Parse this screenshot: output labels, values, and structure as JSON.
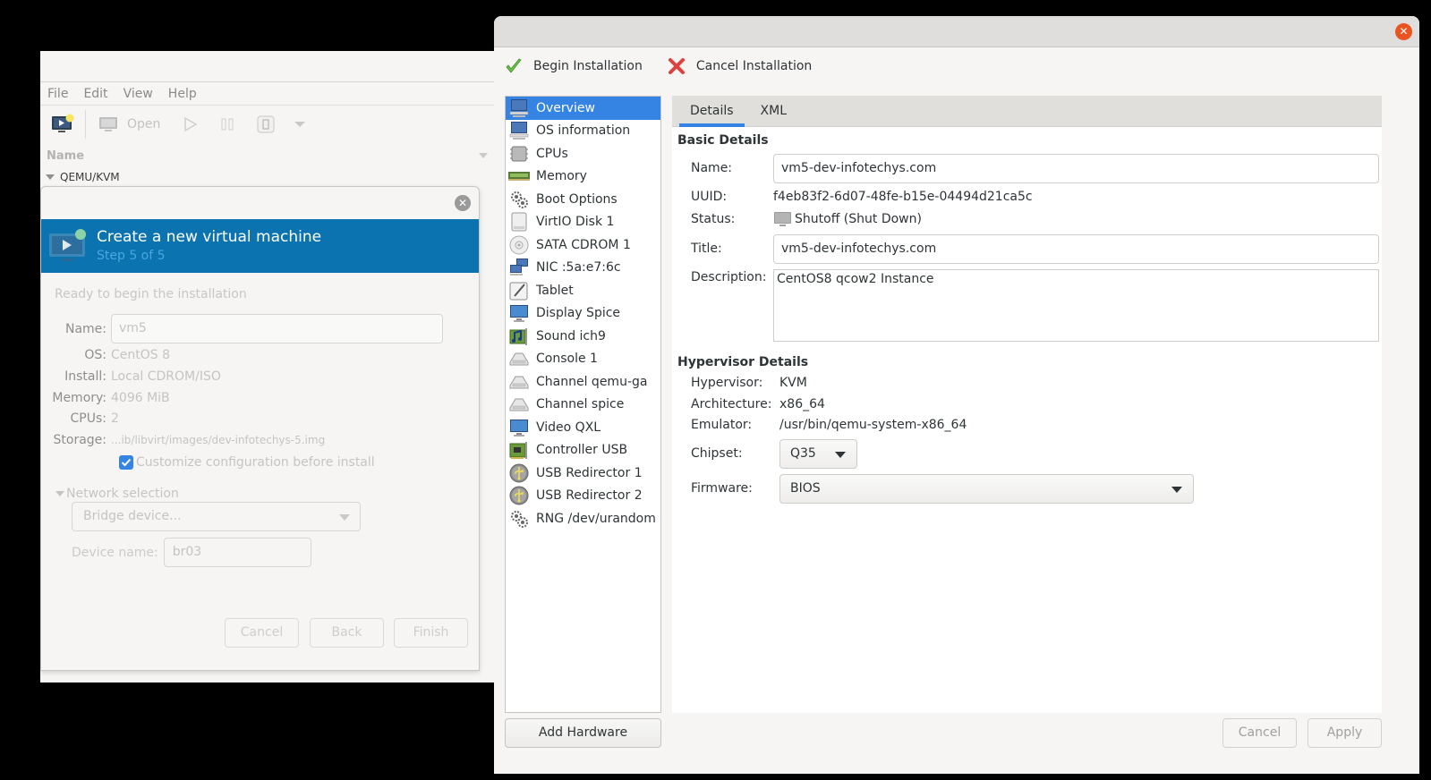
{
  "manager": {
    "menu": [
      "File",
      "Edit",
      "View",
      "Help"
    ],
    "toolbar": {
      "open_label": "Open"
    },
    "column_header": "Name",
    "tree_root": "QEMU/KVM"
  },
  "wizard": {
    "title": "Create a new virtual machine",
    "step": "Step 5 of 5",
    "ready_text": "Ready to begin the installation",
    "fields": {
      "name_label": "Name:",
      "name_value": "vm5",
      "os_label": "OS:",
      "os_value": "CentOS 8",
      "install_label": "Install:",
      "install_value": "Local CDROM/ISO",
      "memory_label": "Memory:",
      "memory_value": "4096 MiB",
      "cpus_label": "CPUs:",
      "cpus_value": "2",
      "storage_label": "Storage:",
      "storage_value": "...ib/libvirt/images/dev-infotechys-5.img"
    },
    "customize_label": "Customize configuration before install",
    "customize_checked": true,
    "network_section": "Network selection",
    "network_source": "Bridge device...",
    "device_name_label": "Device name:",
    "device_name_value": "br03",
    "buttons": {
      "cancel": "Cancel",
      "back": "Back",
      "finish": "Finish"
    }
  },
  "details_window": {
    "actions": {
      "begin": "Begin Installation",
      "cancel": "Cancel Installation"
    },
    "hardware_list": [
      {
        "label": "Overview",
        "icon": "monitor-computer-icon",
        "selected": true
      },
      {
        "label": "OS information",
        "icon": "monitor-computer-icon"
      },
      {
        "label": "CPUs",
        "icon": "cpu-chip-icon"
      },
      {
        "label": "Memory",
        "icon": "memory-module-icon"
      },
      {
        "label": "Boot Options",
        "icon": "gears-icon"
      },
      {
        "label": "VirtIO Disk 1",
        "icon": "hard-disk-icon"
      },
      {
        "label": "SATA CDROM 1",
        "icon": "cdrom-disc-icon"
      },
      {
        "label": "NIC :5a:e7:6c",
        "icon": "network-icon"
      },
      {
        "label": "Tablet",
        "icon": "tablet-pen-icon"
      },
      {
        "label": "Display Spice",
        "icon": "display-icon"
      },
      {
        "label": "Sound ich9",
        "icon": "sound-card-icon"
      },
      {
        "label": "Console 1",
        "icon": "serial-port-icon"
      },
      {
        "label": "Channel qemu-ga",
        "icon": "serial-port-icon"
      },
      {
        "label": "Channel spice",
        "icon": "serial-port-icon"
      },
      {
        "label": "Video QXL",
        "icon": "display-icon"
      },
      {
        "label": "Controller USB",
        "icon": "pci-card-icon"
      },
      {
        "label": "USB Redirector 1",
        "icon": "usb-icon"
      },
      {
        "label": "USB Redirector 2",
        "icon": "usb-icon"
      },
      {
        "label": "RNG /dev/urandom",
        "icon": "gears-icon"
      }
    ],
    "add_hardware": "Add Hardware",
    "tabs": [
      {
        "label": "Details",
        "active": true
      },
      {
        "label": "XML",
        "active": false
      }
    ],
    "basic": {
      "heading": "Basic Details",
      "name_label": "Name:",
      "name_value": "vm5-dev-infotechys.com",
      "uuid_label": "UUID:",
      "uuid_value": "f4eb83f2-6d07-48fe-b15e-04494d21ca5c",
      "status_label": "Status:",
      "status_value": "Shutoff (Shut Down)",
      "title_label": "Title:",
      "title_value": "vm5-dev-infotechys.com",
      "description_label": "Description:",
      "description_value": "CentOS8 qcow2 Instance"
    },
    "hypervisor": {
      "heading": "Hypervisor Details",
      "hypervisor_label": "Hypervisor:",
      "hypervisor_value": "KVM",
      "arch_label": "Architecture:",
      "arch_value": "x86_64",
      "emulator_label": "Emulator:",
      "emulator_value": "/usr/bin/qemu-system-x86_64",
      "chipset_label": "Chipset:",
      "chipset_value": "Q35",
      "firmware_label": "Firmware:",
      "firmware_value": "BIOS"
    },
    "buttons": {
      "cancel": "Cancel",
      "apply": "Apply"
    }
  },
  "colors": {
    "accent": "#3584e4",
    "banner": "#0a73b0",
    "close": "#e95420"
  }
}
